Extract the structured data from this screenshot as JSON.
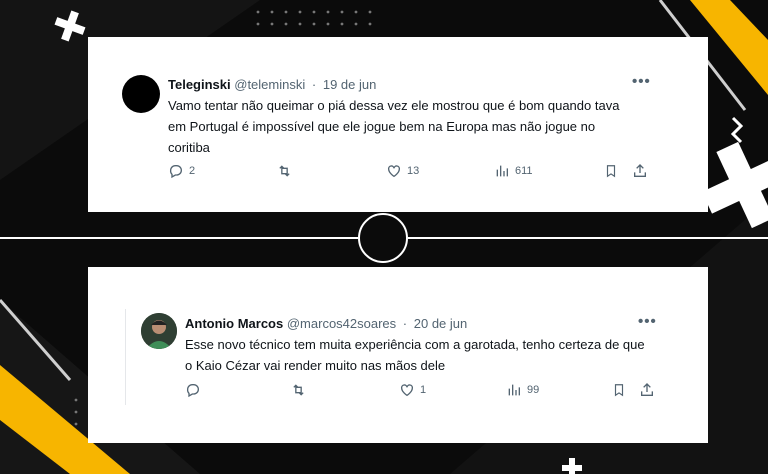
{
  "tweets": [
    {
      "display_name": "Teleginski",
      "handle": "@teleminski",
      "date": "19 de jun",
      "text": "Vamo tentar não queimar o piá dessa vez ele mostrou que é bom quando tava em Portugal é impossível que ele jogue bem na Europa mas não jogue no coritiba",
      "replies": "2",
      "retweets": "",
      "likes": "13",
      "views": "611",
      "more": "•••"
    },
    {
      "display_name": "Antonio Marcos",
      "handle": "@marcos42soares",
      "date": "20 de jun",
      "text": "Esse novo técnico tem muita experiência com a garotada, tenho certeza de que o Kaio Cézar vai render muito nas mãos dele",
      "replies": "",
      "retweets": "",
      "likes": "1",
      "views": "99",
      "more": "•••"
    }
  ],
  "separator": "·",
  "colors": {
    "background": "#0b0b0b",
    "accent_yellow": "#f7b500",
    "card": "#ffffff",
    "text": "#0f1419",
    "muted": "#536471"
  },
  "icons": [
    "reply-icon",
    "retweet-icon",
    "like-icon",
    "views-icon",
    "bookmark-icon",
    "share-icon",
    "more-icon"
  ]
}
